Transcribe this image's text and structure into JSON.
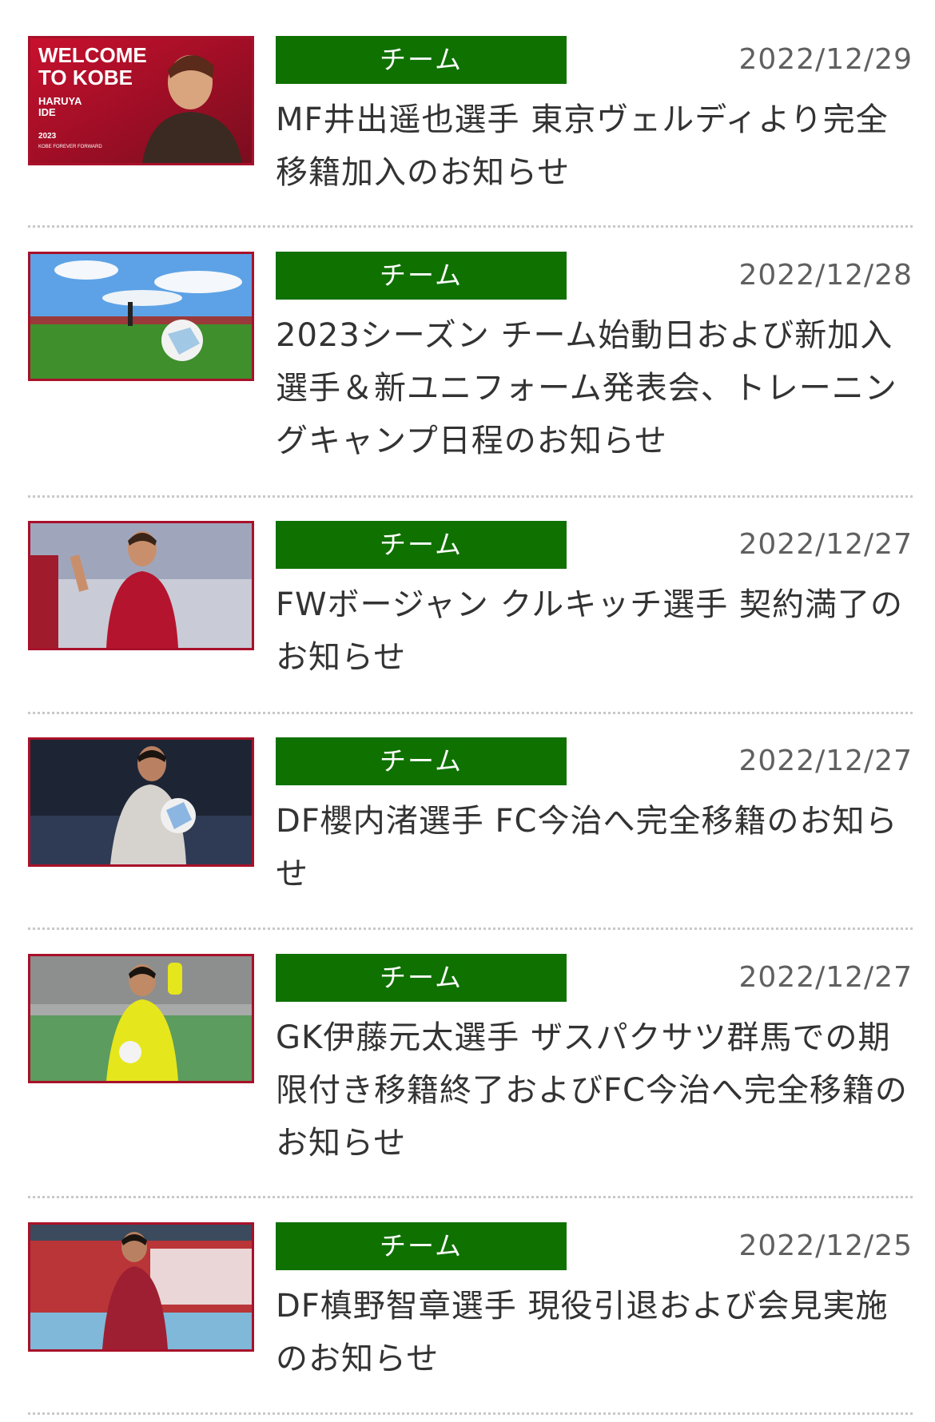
{
  "news": [
    {
      "category": "チーム",
      "date": "2022/12/29",
      "title": "MF井出遥也選手 東京ヴェルディより完全移籍加入のお知らせ",
      "image": "welcome-to-kobe-graphic",
      "image_text": [
        "WELCOME",
        "TO KOBE",
        "HARUYA",
        "IDE",
        "2023",
        "KOBE FOREVER FORWARD"
      ]
    },
    {
      "category": "チーム",
      "date": "2022/12/28",
      "title": "2023シーズン チーム始動日および新加入選手＆新ユニフォーム発表会、トレーニングキャンプ日程のお知らせ",
      "image": "soccer-ball-on-pitch"
    },
    {
      "category": "チーム",
      "date": "2022/12/27",
      "title": "FWボージャン クルキッチ選手 契約満了のお知らせ",
      "image": "player-in-red-kit"
    },
    {
      "category": "チーム",
      "date": "2022/12/27",
      "title": "DF櫻内渚選手 FC今治へ完全移籍のお知らせ",
      "image": "player-in-white-kit-with-ball"
    },
    {
      "category": "チーム",
      "date": "2022/12/27",
      "title": "GK伊藤元太選手 ザスパクサツ群馬での期限付き移籍終了およびFC今治へ完全移籍のお知らせ",
      "image": "goalkeeper-in-yellow-kit"
    },
    {
      "category": "チーム",
      "date": "2022/12/25",
      "title": "DF槙野智章選手 現役引退および会見実施のお知らせ",
      "image": "player-in-red-kit-running"
    }
  ],
  "colors": {
    "category_bg": "#0f7100",
    "thumb_border": "#a8112a",
    "date_text": "#606060",
    "title_text": "#333333"
  }
}
